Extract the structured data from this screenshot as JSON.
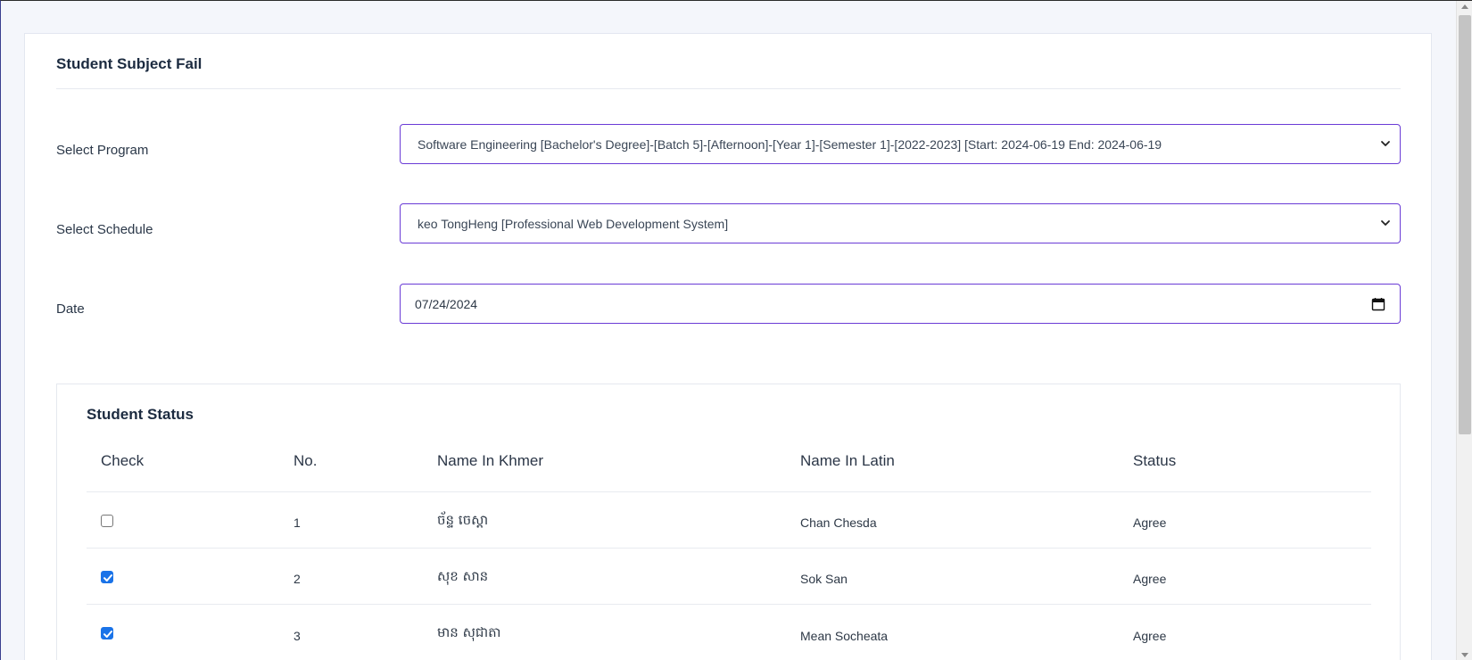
{
  "card": {
    "title": "Student Subject Fail"
  },
  "form": {
    "program": {
      "label": "Select Program",
      "value": "Software Engineering [Bachelor's Degree]-[Batch 5]-[Afternoon]-[Year 1]-[Semester 1]-[2022-2023] [Start: 2024-06-19 End: 2024-06-19"
    },
    "schedule": {
      "label": "Select Schedule",
      "value": "keo TongHeng [Professional Web Development System]"
    },
    "date": {
      "label": "Date",
      "value": "07/24/2024"
    }
  },
  "status_table": {
    "title": "Student Status",
    "headers": [
      "Check",
      "No.",
      "Name In Khmer",
      "Name In Latin",
      "Status"
    ],
    "rows": [
      {
        "checked": false,
        "no": "1",
        "khmer": "ច័ន្ទ ចេស្ដា",
        "latin": "Chan Chesda",
        "status": "Agree"
      },
      {
        "checked": true,
        "no": "2",
        "khmer": "សុខ សាន",
        "latin": "Sok San",
        "status": "Agree"
      },
      {
        "checked": true,
        "no": "3",
        "khmer": "មាន សុជាតា",
        "latin": "Mean Socheata",
        "status": "Agree"
      }
    ]
  },
  "colors": {
    "accent_border": "#6a3bd6",
    "checkbox_checked": "#1a73e8",
    "page_bg": "#f4f6fb"
  },
  "icons": {
    "select_caret": "chevron-down-icon",
    "date_picker": "calendar-icon",
    "checkbox": "checkbox-icon"
  }
}
